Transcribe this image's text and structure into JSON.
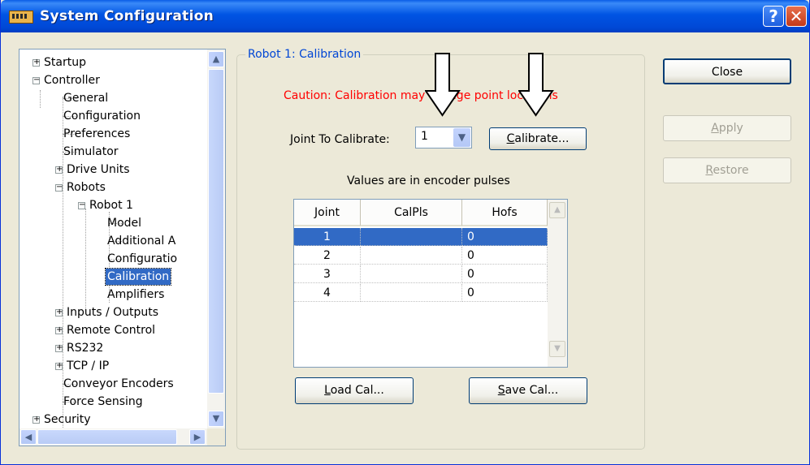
{
  "window": {
    "title": "System Configuration"
  },
  "tree": {
    "items": [
      {
        "label": "Startup",
        "expander": "+"
      },
      {
        "label": "Controller",
        "expander": "−"
      },
      {
        "label": "General"
      },
      {
        "label": "Configuration"
      },
      {
        "label": "Preferences"
      },
      {
        "label": "Simulator"
      },
      {
        "label": "Drive Units",
        "expander": "+"
      },
      {
        "label": "Robots",
        "expander": "−"
      },
      {
        "label": "Robot 1",
        "expander": "−"
      },
      {
        "label": "Model"
      },
      {
        "label": "Additional A"
      },
      {
        "label": "Configuratio"
      },
      {
        "label": "Calibration",
        "selected": true
      },
      {
        "label": "Amplifiers"
      },
      {
        "label": "Inputs / Outputs",
        "expander": "+"
      },
      {
        "label": "Remote Control",
        "expander": "+"
      },
      {
        "label": "RS232",
        "expander": "+"
      },
      {
        "label": "TCP / IP",
        "expander": "+"
      },
      {
        "label": "Conveyor Encoders"
      },
      {
        "label": "Force Sensing"
      },
      {
        "label": "Security",
        "expander": "+"
      }
    ]
  },
  "calibration": {
    "group_title": "Robot 1: Calibration",
    "caution": "Caution: Calibration may change point locations",
    "joint_label_prefix": "J",
    "joint_label_rest": "oint To Calibrate:",
    "joint_value": "1",
    "calibrate_prefix": "C",
    "calibrate_rest": "alibrate...",
    "values_note": "Values are in encoder pulses",
    "columns": [
      "Joint",
      "CalPls",
      "Hofs"
    ],
    "rows": [
      {
        "joint": "1",
        "calpls": "",
        "hofs": "0",
        "selected": true
      },
      {
        "joint": "2",
        "calpls": "",
        "hofs": "0"
      },
      {
        "joint": "3",
        "calpls": "",
        "hofs": "0"
      },
      {
        "joint": "4",
        "calpls": "",
        "hofs": "0"
      }
    ],
    "load_prefix": "L",
    "load_rest": "oad Cal...",
    "save_prefix": "S",
    "save_rest": "ave Cal..."
  },
  "buttons": {
    "close": "Close",
    "apply_prefix": "A",
    "apply_rest": "pply",
    "restore_prefix": "R",
    "restore_rest": "estore"
  },
  "colors": {
    "caution": "#ff0000",
    "group_title": "#0046d5",
    "selection": "#316ac5"
  }
}
